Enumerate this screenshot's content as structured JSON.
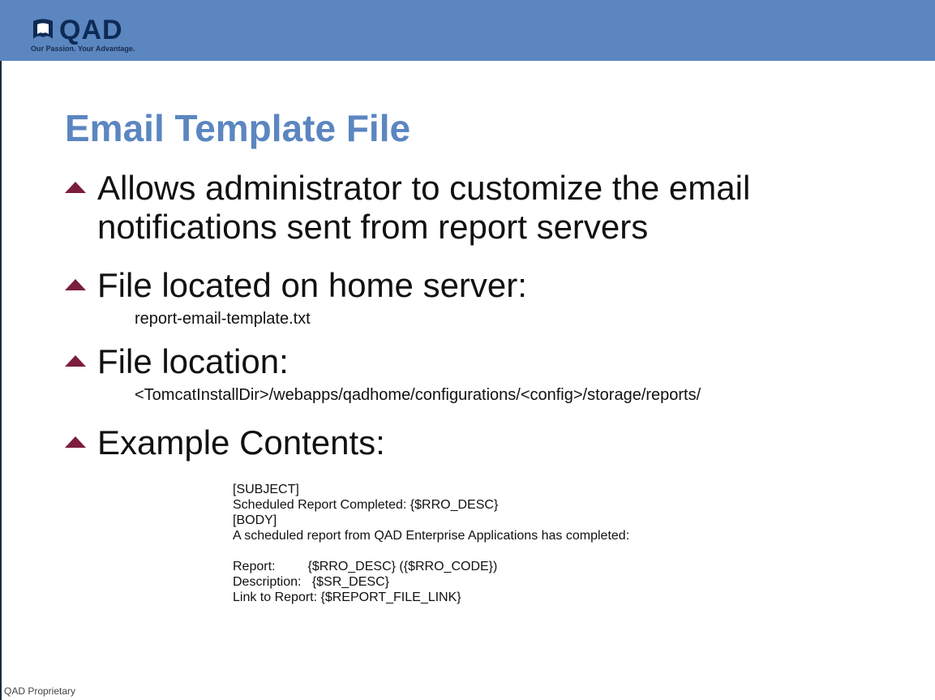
{
  "header": {
    "logo_word": "QAD",
    "logo_tagline": "Our Passion. Your Advantage.",
    "logo_icon": "qad-shield-icon",
    "bar_color": "#5b86c0"
  },
  "slide": {
    "title": "Email Template File",
    "bullets": [
      {
        "text_lines": [
          "Allows administrator to customize the email",
          "notifications sent from report servers"
        ]
      },
      {
        "text_lines": [
          "File located on home server:"
        ],
        "sub": "report-email-template.txt"
      },
      {
        "text_lines": [
          "File location:"
        ],
        "sub": "<TomcatInstallDir>/webapps/qadhome/configurations/<config>/storage/reports/"
      },
      {
        "text_lines": [
          "Example Contents:"
        ]
      }
    ],
    "example_lines": [
      "[SUBJECT]",
      "Scheduled Report Completed: {$RRO_DESC}",
      "[BODY]",
      "A scheduled report from QAD Enterprise Applications has completed:",
      "",
      "Report:         {$RRO_DESC} ({$RRO_CODE})",
      "Description:   {$SR_DESC}",
      "Link to Report: {$REPORT_FILE_LINK}"
    ]
  },
  "footer": {
    "text": "QAD Proprietary"
  },
  "colors": {
    "title": "#5b86c0",
    "bullet_arrow": "#7b1e3c",
    "logo_text": "#0d2a55"
  }
}
